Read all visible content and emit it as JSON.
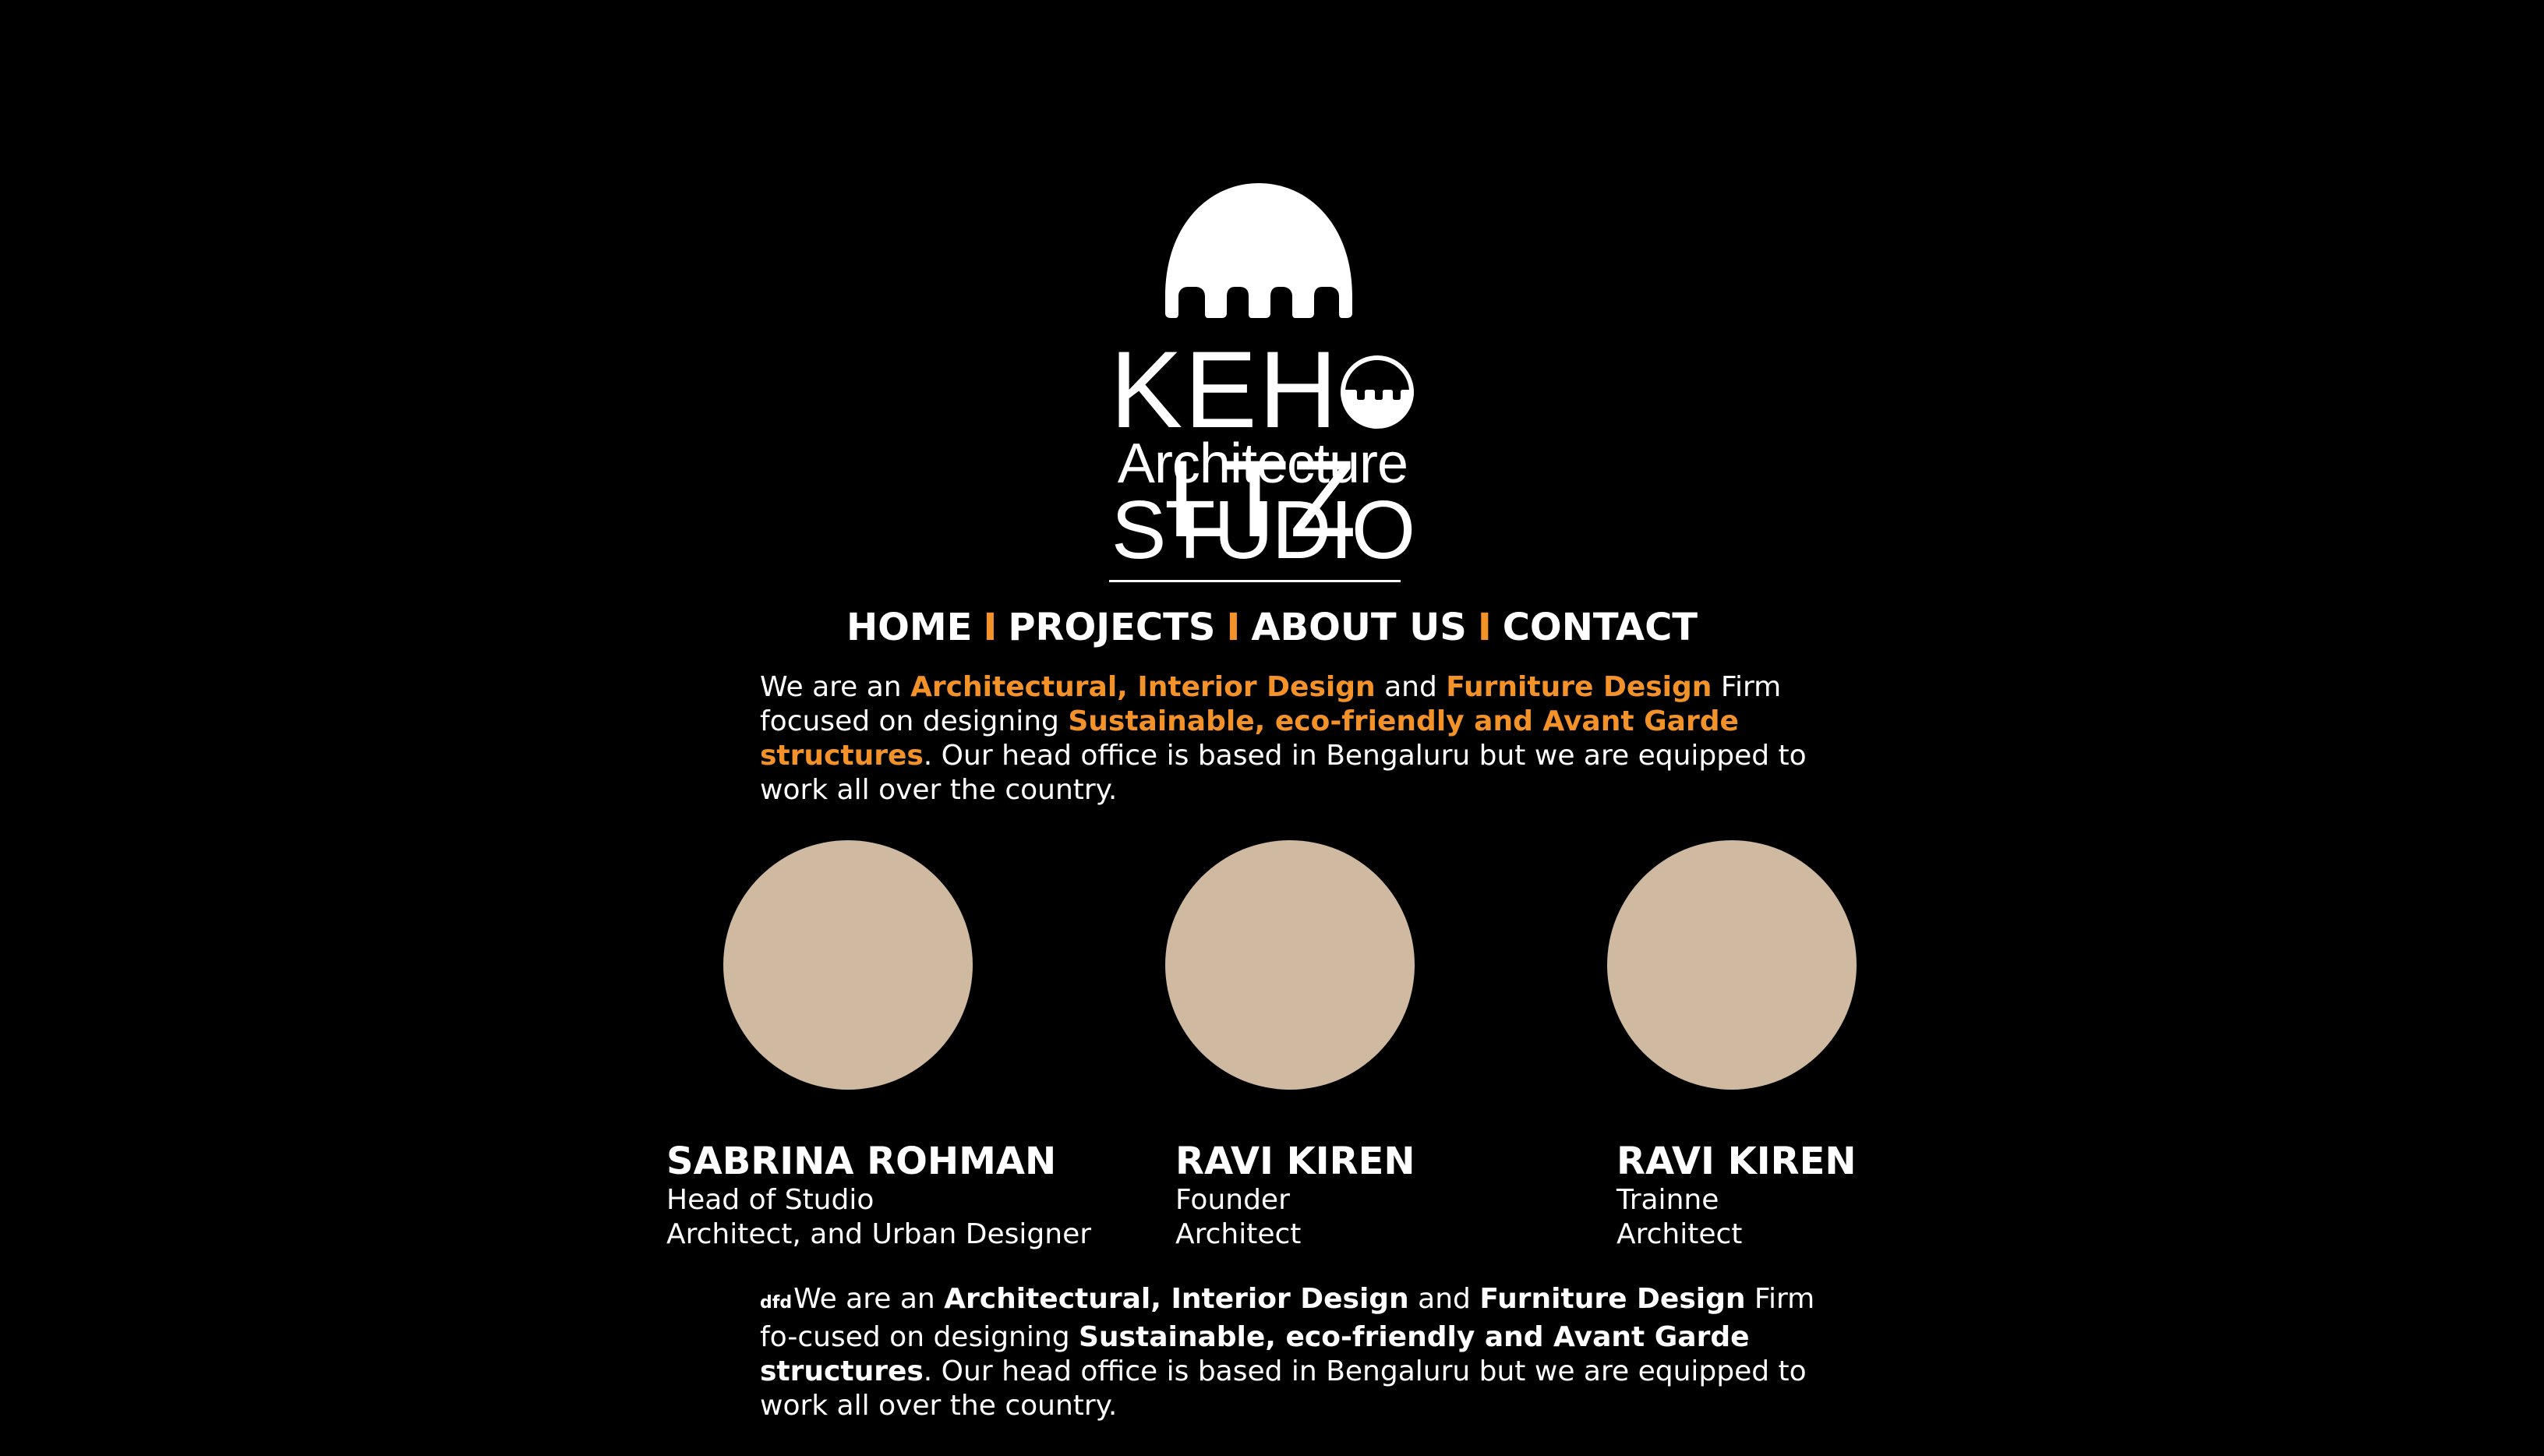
{
  "brand": {
    "logo_icon": "dome-arch-icon",
    "word_left": "KEH",
    "word_right": "LTZ",
    "subtitle": "Architecture",
    "studio": "STUDIO"
  },
  "nav": {
    "items": [
      {
        "label": "HOME"
      },
      {
        "label": "PROJECTS"
      },
      {
        "label": "ABOUT US"
      },
      {
        "label": "CONTACT"
      }
    ],
    "separator": "I",
    "separator_color": "#f39229"
  },
  "intro": {
    "t1": "We are an ",
    "h1": "Architectural, Interior Design",
    "t2": " and ",
    "h2": "Furniture Design",
    "t3": " Firm focused on designing  ",
    "h3": "Sustainable, eco-friendly and Avant Garde structures",
    "t4": ". Our head office is based in Bengaluru but we are equipped to work all over the country."
  },
  "team": [
    {
      "name": "SABRINA ROHMAN",
      "role_line1": "Head of Studio",
      "role_line2": "Architect, and Urban Designer"
    },
    {
      "name": "RAVI KIREN",
      "role_line1": "Founder",
      "role_line2": "Architect"
    },
    {
      "name": "RAVI KIREN",
      "role_line1": "Trainne",
      "role_line2": "Architect"
    }
  ],
  "outro": {
    "prefix": "dfd",
    "t1": "We are an ",
    "b1": "Architectural, Interior Design",
    "t2": " and ",
    "b2": "Furniture Design",
    "t3": " Firm fo-cused on designing  ",
    "b3": "Sustainable, eco-friendly and Avant Garde structures",
    "t4": ". Our head office is based in Bengaluru but we are equipped to work all over the country."
  },
  "colors": {
    "background": "#000000",
    "accent": "#f39229",
    "avatar_placeholder": "#cfb9a1",
    "text": "#ffffff"
  }
}
